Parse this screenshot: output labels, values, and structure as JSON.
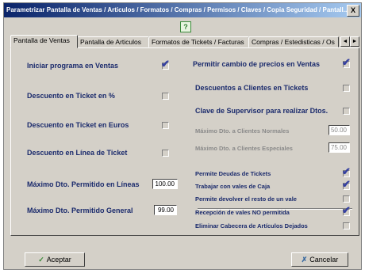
{
  "window": {
    "title": "Parametrizar Pantalla de Ventas / Articulos / Formatos / Compras / Permisos / Claves / Copia Seguridad / Pantall...",
    "close_label": "X",
    "help_label": "?"
  },
  "tabs": [
    {
      "label": "Pantalla de Ventas",
      "active": true
    },
    {
      "label": "Pantalla de Articulos",
      "active": false
    },
    {
      "label": "Formatos de Tickets / Facturas",
      "active": false
    },
    {
      "label": "Compras / Estedisticas / Os",
      "active": false
    }
  ],
  "tab_scroll": {
    "left": "◄",
    "right": "►"
  },
  "left_options": [
    {
      "label": "Iniciar programa en Ventas",
      "checked": true
    },
    {
      "label": "Descuento en Ticket en %",
      "checked": false
    },
    {
      "label": "Descuento en Ticket en Euros",
      "checked": false
    },
    {
      "label": "Descuento en Línea de Ticket",
      "checked": false
    }
  ],
  "left_fields": [
    {
      "label": "Máximo Dto. Permitido en Líneas",
      "value": "100.00"
    },
    {
      "label": "Máximo Dto. Permitido General",
      "value": "99.00"
    }
  ],
  "right_options": [
    {
      "label": "Permitir cambio de precios en Ventas",
      "checked": true
    },
    {
      "label": "Descuentos a Clientes en Tickets",
      "checked": false
    },
    {
      "label": "Clave de Supervisor para realizar Dtos.",
      "checked": false
    }
  ],
  "right_fields": [
    {
      "label": "Máximo Dto. a Clientes Normales",
      "value": "50.00"
    },
    {
      "label": "Máximo Dto. a Clientes Especiales",
      "value": "75.00"
    }
  ],
  "right_small_options": [
    {
      "label": "Permite Deudas de Tickets",
      "checked": true
    },
    {
      "label": "Trabajar con vales de Caja",
      "checked": true
    },
    {
      "label": "Permite devolver el resto de un vale",
      "checked": false
    },
    {
      "label": "Recepción de vales NO permitida",
      "checked": true
    },
    {
      "label": "Eliminar Cabecera de Artículos Dejados",
      "checked": false
    }
  ],
  "buttons": {
    "accept_label": "Aceptar",
    "cancel_label": "Cancelar"
  },
  "check_glyph": "✔",
  "accept_glyph": "✓",
  "cancel_glyph": "✗"
}
